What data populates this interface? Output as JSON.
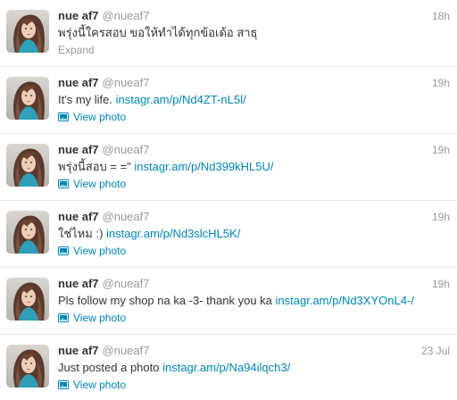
{
  "colors": {
    "link": "#0084b4",
    "muted": "#999999",
    "text": "#333333",
    "divider": "#e8e8e8"
  },
  "tweets": [
    {
      "fullname": "nue af7",
      "username": "@nueaf7",
      "time": "18h",
      "text": "พรุ่งนี้ใครสอบ ขอให้ทำได้ทุกข้อเด้อ สาธุ",
      "link": "",
      "footer": "Expand",
      "footer_type": "expand",
      "avatar_icon": "profile-photo"
    },
    {
      "fullname": "nue af7",
      "username": "@nueaf7",
      "time": "19h",
      "text": "It's my life. ",
      "link": "instagr.am/p/Nd4ZT-nL5l/",
      "footer": "View photo",
      "footer_type": "photo",
      "avatar_icon": "profile-photo"
    },
    {
      "fullname": "nue af7",
      "username": "@nueaf7",
      "time": "19h",
      "text": "พรุ่งนี้สอบ = =\" ",
      "link": "instagr.am/p/Nd399kHL5U/",
      "footer": "View photo",
      "footer_type": "photo",
      "avatar_icon": "profile-photo"
    },
    {
      "fullname": "nue af7",
      "username": "@nueaf7",
      "time": "19h",
      "text": "ใช่ไหม :) ",
      "link": "instagr.am/p/Nd3slcHL5K/",
      "footer": "View photo",
      "footer_type": "photo",
      "avatar_icon": "profile-photo"
    },
    {
      "fullname": "nue af7",
      "username": "@nueaf7",
      "time": "19h",
      "text": "Pls follow my shop na ka -3- thank you ka ",
      "link": "instagr.am/p/Nd3XYOnL4-/",
      "footer": "View photo",
      "footer_type": "photo",
      "avatar_icon": "profile-photo"
    },
    {
      "fullname": "nue af7",
      "username": "@nueaf7",
      "time": "23 Jul",
      "text": "Just posted a photo ",
      "link": "instagr.am/p/Na94ilqch3/",
      "footer": "View photo",
      "footer_type": "photo",
      "avatar_icon": "profile-photo"
    }
  ]
}
